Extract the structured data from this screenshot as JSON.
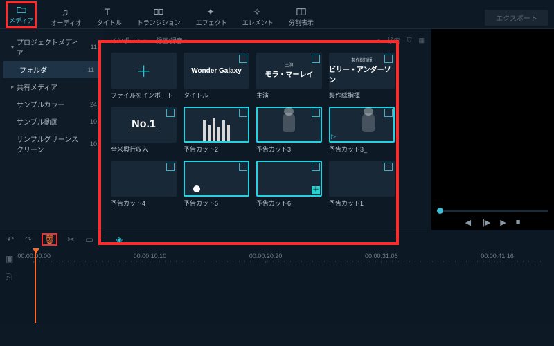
{
  "toolbar": {
    "tabs": [
      {
        "id": "media",
        "label": "メディア",
        "icon": "folder"
      },
      {
        "id": "audio",
        "label": "オーディオ",
        "icon": "music"
      },
      {
        "id": "title",
        "label": "タイトル",
        "icon": "text"
      },
      {
        "id": "transition",
        "label": "トランジション",
        "icon": "transition"
      },
      {
        "id": "effect",
        "label": "エフェクト",
        "icon": "sparkle"
      },
      {
        "id": "element",
        "label": "エレメント",
        "icon": "star"
      },
      {
        "id": "split",
        "label": "分割表示",
        "icon": "split"
      }
    ],
    "active": "media",
    "export_label": "エクスポート"
  },
  "sidebar": {
    "items": [
      {
        "label": "プロジェクトメディア",
        "count": 11,
        "expandable": true
      },
      {
        "label": "フォルダ",
        "count": 11,
        "selected": true,
        "indent": 1
      },
      {
        "label": "共有メディア",
        "count": "",
        "expandable": true
      },
      {
        "label": "サンプルカラー",
        "count": 24,
        "indent": 1
      },
      {
        "label": "サンプル動画",
        "count": 10,
        "indent": 1
      },
      {
        "label": "サンプルグリーンスクリーン",
        "count": 10,
        "indent": 1
      }
    ]
  },
  "media_panel": {
    "head": {
      "import": "インポート",
      "record": "録画/録音",
      "search": "検索"
    },
    "items": [
      {
        "id": "import",
        "label": "ファイルをインポート",
        "kind": "import"
      },
      {
        "id": "t1",
        "label": "タイトル",
        "kind": "title",
        "text_top": "",
        "text_main": "Wonder Galaxy",
        "text_sub": ""
      },
      {
        "id": "t2",
        "label": "主演",
        "kind": "title",
        "text_top": "主演",
        "text_main": "モラ・マーレイ",
        "text_sub": ""
      },
      {
        "id": "t3",
        "label": "製作総指揮",
        "kind": "title",
        "text_top": "製作総指揮",
        "text_main": "ビリー・アンダーソン",
        "text_sub": ""
      },
      {
        "id": "no1",
        "label": "全米興行収入",
        "kind": "no1",
        "text": "No.1"
      },
      {
        "id": "c2",
        "label": "予告カット2",
        "kind": "warehouse",
        "selected": true
      },
      {
        "id": "c3",
        "label": "予告カット3",
        "kind": "mars1",
        "selected": true
      },
      {
        "id": "c3b",
        "label": "予告カット3_",
        "kind": "mars2",
        "selected": true
      },
      {
        "id": "c4",
        "label": "予告カット4",
        "kind": "mars3"
      },
      {
        "id": "c5",
        "label": "予告カット5",
        "kind": "city",
        "selected": true
      },
      {
        "id": "c6",
        "label": "予告カット6",
        "kind": "mars4",
        "selected": true,
        "show_plus": true
      },
      {
        "id": "c1",
        "label": "予告カット1",
        "kind": "mars2"
      }
    ]
  },
  "timeline": {
    "marks": [
      "00:00:00:00",
      "00:00:10:10",
      "00:00:20:20",
      "00:00:31:06",
      "00:00:41:16"
    ]
  },
  "preview": {
    "controls": [
      "prev",
      "play-step",
      "play",
      "stop"
    ]
  }
}
